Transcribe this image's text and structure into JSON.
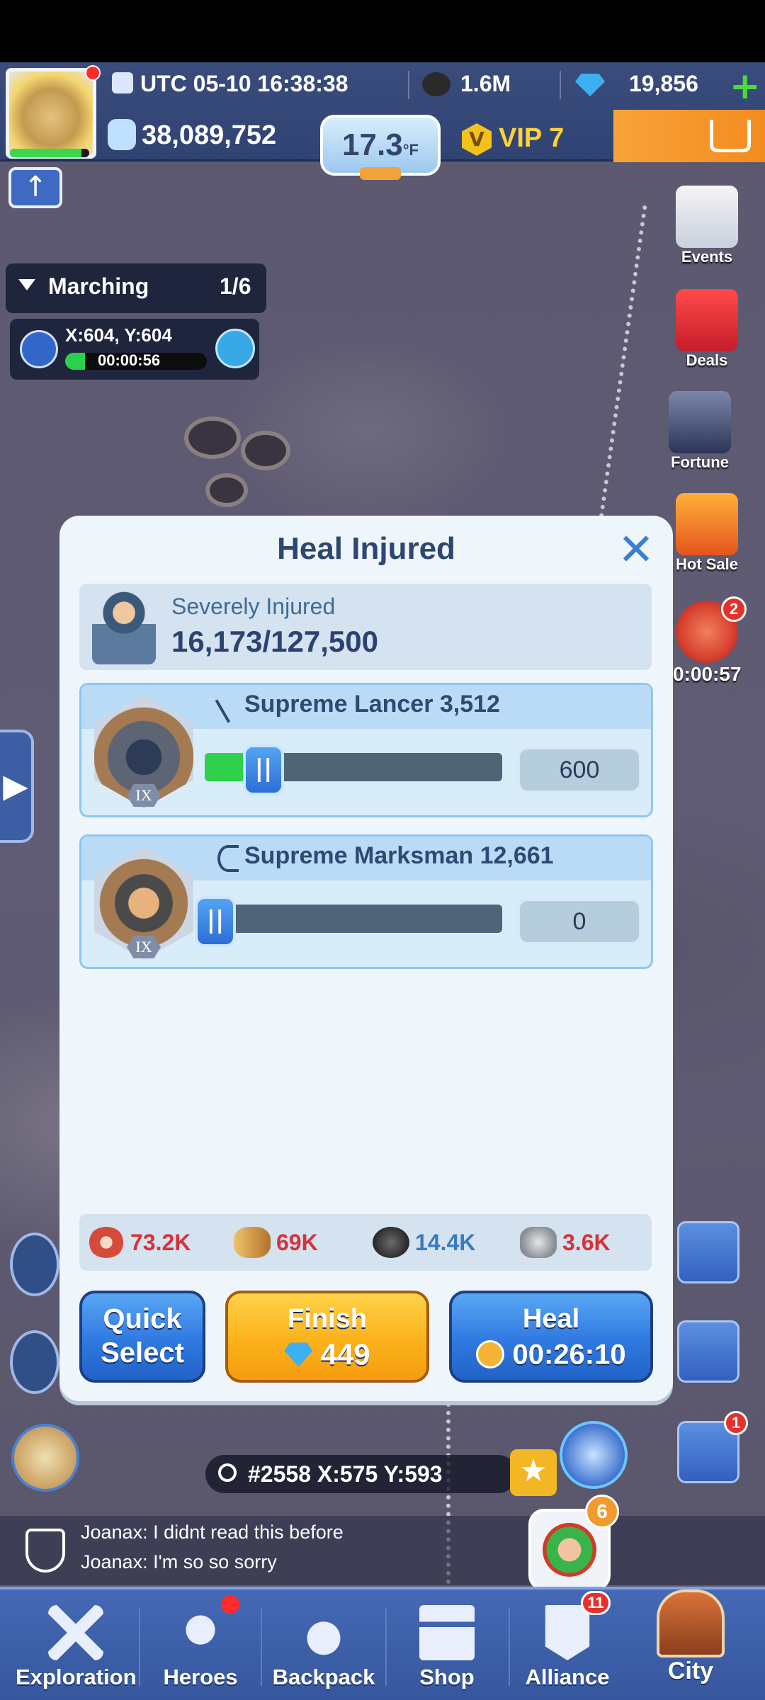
{
  "hud": {
    "time": "UTC 05-10 16:38:38",
    "coal": "1.6M",
    "gems": "19,856",
    "power": "38,089,752",
    "temperature": "17.3",
    "temp_unit": "°F",
    "vip": "VIP 7",
    "vip_badge": "V"
  },
  "marching": {
    "label": "Marching",
    "count": "1/6",
    "coords": "X:604, Y:604",
    "timer": "00:00:56",
    "progress": 0.14
  },
  "side": {
    "events": "Events",
    "deals": "Deals",
    "fortune": "Fortune",
    "hot_sale": "Hot Sale",
    "raid_badge": "2",
    "raid_timer": "0:00:57",
    "mail_badge": "1"
  },
  "dialog": {
    "title": "Heal Injured",
    "injured_label": "Severely Injured",
    "injured_value": "16,173/127,500",
    "troops": [
      {
        "name": "Supreme Lancer 3,512",
        "tier": "IX",
        "quantity": "600",
        "fill": 0.17
      },
      {
        "name": "Supreme Marksman 12,661",
        "tier": "IX",
        "quantity": "0",
        "fill": 0
      }
    ],
    "resources": {
      "meat": "73.2K",
      "wood": "69K",
      "coal": "14.4K",
      "iron": "3.6K"
    },
    "buttons": {
      "quick_select_1": "Quick",
      "quick_select_2": "Select",
      "finish": "Finish",
      "finish_cost": "449",
      "heal": "Heal",
      "heal_time": "00:26:10"
    }
  },
  "map": {
    "coords": "#2558 X:575  Y:593"
  },
  "chat": {
    "line1": "Joanax: I didnt read this before",
    "line2": "Joanax: I'm so so sorry"
  },
  "alliance_help_badge": "6",
  "nav": {
    "exploration": "Exploration",
    "heroes": "Heroes",
    "backpack": "Backpack",
    "shop": "Shop",
    "alliance": "Alliance",
    "alliance_badge": "11",
    "city": "City"
  },
  "colors": {
    "accent_blue": "#2f79e0",
    "gold": "#fbb21a",
    "red_text": "#d6323a",
    "blue_text": "#3b7bbd"
  }
}
